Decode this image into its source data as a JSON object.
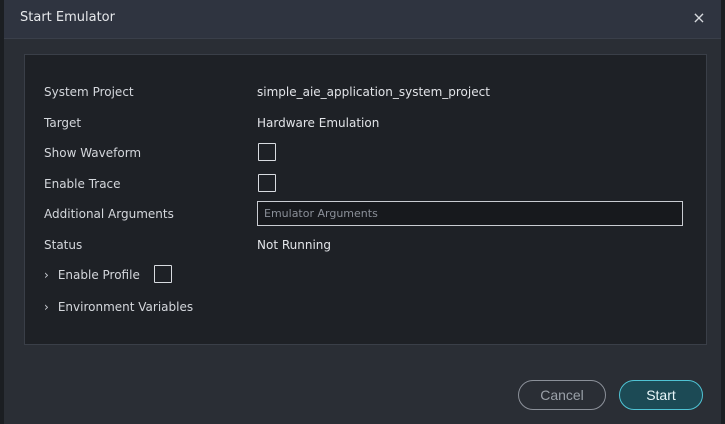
{
  "dialog": {
    "title": "Start Emulator",
    "close_glyph": "×"
  },
  "form": {
    "system_project_label": "System Project",
    "system_project_value": "simple_aie_application_system_project",
    "target_label": "Target",
    "target_value": "Hardware Emulation",
    "show_waveform_label": "Show Waveform",
    "show_waveform_checked": false,
    "enable_trace_label": "Enable Trace",
    "enable_trace_checked": false,
    "additional_arguments_label": "Additional Arguments",
    "additional_arguments_value": "",
    "additional_arguments_placeholder": "Emulator Arguments",
    "status_label": "Status",
    "status_value": "Not Running",
    "enable_profile_label": "Enable Profile",
    "enable_profile_checked": false,
    "environment_variables_label": "Environment Variables",
    "chevron_glyph": "›"
  },
  "buttons": {
    "cancel_label": "Cancel",
    "start_label": "Start"
  },
  "colors": {
    "dialog_bg": "#2a2e35",
    "panel_bg": "#1e2126",
    "accent": "#4fc3d4"
  },
  "icons": {
    "close": "close-icon",
    "expand": "chevron-right-icon"
  }
}
